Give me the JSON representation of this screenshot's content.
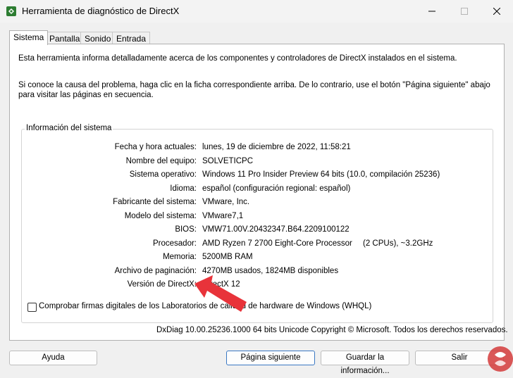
{
  "window": {
    "title": "Herramienta de diagnóstico de DirectX",
    "minimize_icon": "minimize-icon",
    "maximize_icon": "maximize-icon",
    "close_icon": "close-icon"
  },
  "tabs": [
    {
      "label": "Sistema",
      "active": true
    },
    {
      "label": "Pantalla",
      "active": false
    },
    {
      "label": "Sonido",
      "active": false
    },
    {
      "label": "Entrada",
      "active": false
    }
  ],
  "intro": {
    "line1": "Esta herramienta informa detalladamente acerca de los componentes y controladores de DirectX instalados en el sistema.",
    "line2": "Si conoce la causa del problema, haga clic en la ficha correspondiente arriba. De lo contrario, use el botón \"Página siguiente\" abajo para visitar las páginas en secuencia."
  },
  "system_info": {
    "title": "Información del sistema",
    "rows": [
      {
        "label": "Fecha y hora actuales:",
        "value": "lunes, 19 de diciembre de 2022, 11:58:21"
      },
      {
        "label": "Nombre del equipo:",
        "value": "SOLVETICPC"
      },
      {
        "label": "Sistema operativo:",
        "value": "Windows 11 Pro Insider Preview 64 bits (10.0, compilación 25236)"
      },
      {
        "label": "Idioma:",
        "value": "español (configuración regional: español)"
      },
      {
        "label": "Fabricante del sistema:",
        "value": "VMware, Inc."
      },
      {
        "label": "Modelo del sistema:",
        "value": "VMware7,1"
      },
      {
        "label": "BIOS:",
        "value": "VMW71.00V.20432347.B64.2209100122"
      },
      {
        "label": "Procesador:",
        "value": "AMD Ryzen 7 2700 Eight-Core Processor",
        "extra": "(2 CPUs), ~3.2GHz"
      },
      {
        "label": "Memoria:",
        "value": "5200MB RAM"
      },
      {
        "label": "Archivo de paginación:",
        "value": "4270MB usados, 1824MB disponibles"
      },
      {
        "label": "Versión de DirectX:",
        "value": "DirectX 12"
      }
    ]
  },
  "whql": {
    "label": "Comprobar firmas digitales de los Laboratorios de calidad de hardware de Windows (WHQL)",
    "checked": false
  },
  "copyright": "DxDiag 10.00.25236.1000 64 bits Unicode  Copyright © Microsoft. Todos los derechos reservados.",
  "buttons": {
    "help": "Ayuda",
    "next": "Página siguiente",
    "save": "Guardar la información...",
    "exit": "Salir"
  },
  "colors": {
    "accent_border": "#3a78c3",
    "annotation_arrow": "#e8333a"
  }
}
